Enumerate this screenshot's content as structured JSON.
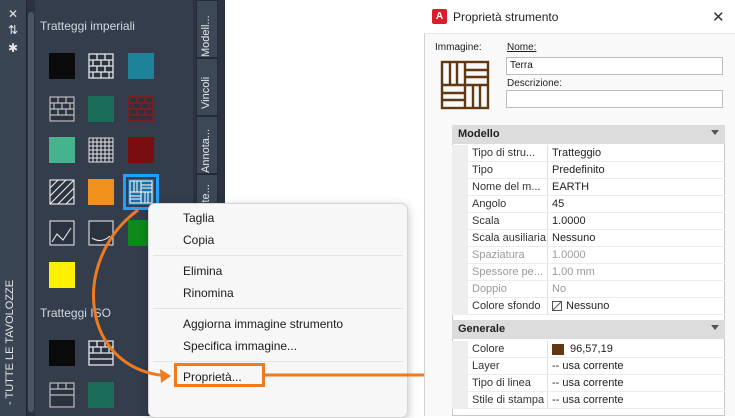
{
  "palette": {
    "vertical_title": "- TUTTE LE TAVOLOZZE",
    "category1": "Tratteggi imperiali",
    "category2": "Tratteggi ISO",
    "tabs": [
      "Modell...",
      "Vincoli",
      "Annota...",
      "ite..."
    ]
  },
  "context_menu": {
    "items": [
      "Taglia",
      "Copia",
      "Elimina",
      "Rinomina",
      "Aggiorna immagine strumento",
      "Specifica immagine...",
      "Proprietà..."
    ]
  },
  "dialog": {
    "title": "Proprietà strumento",
    "close_glyph": "✕",
    "logo_letter": "A",
    "image_label": "Immagine:",
    "name_label": "Nome:",
    "name_value": "Terra",
    "desc_label": "Descrizione:",
    "desc_value": "",
    "groups": {
      "modello": "Modello",
      "generale": "Generale"
    },
    "modello_rows": [
      {
        "k": "Tipo di stru...",
        "v": "Tratteggio"
      },
      {
        "k": "Tipo",
        "v": "Predefinito"
      },
      {
        "k": "Nome del m...",
        "v": "EARTH"
      },
      {
        "k": "Angolo",
        "v": "45"
      },
      {
        "k": "Scala",
        "v": "1.0000"
      },
      {
        "k": "Scala ausiliaria",
        "v": "Nessuno"
      },
      {
        "k": "Spaziatura",
        "v": "1.0000"
      },
      {
        "k": "Spessore pe...",
        "v": "1.00 mm"
      },
      {
        "k": "Doppio",
        "v": "No"
      },
      {
        "k": "Colore sfondo",
        "v": "Nessuno"
      }
    ],
    "generale_rows": [
      {
        "k": "Colore",
        "v": "96,57,19"
      },
      {
        "k": "Layer",
        "v": "-- usa corrente"
      },
      {
        "k": "Tipo di linea",
        "v": "-- usa corrente"
      },
      {
        "k": "Stile di stampa",
        "v": "-- usa corrente"
      }
    ]
  },
  "colors": {
    "accent_orange": "#ee7b1f",
    "selection_blue": "#1ea1ff",
    "hatch_color": "#603913"
  }
}
